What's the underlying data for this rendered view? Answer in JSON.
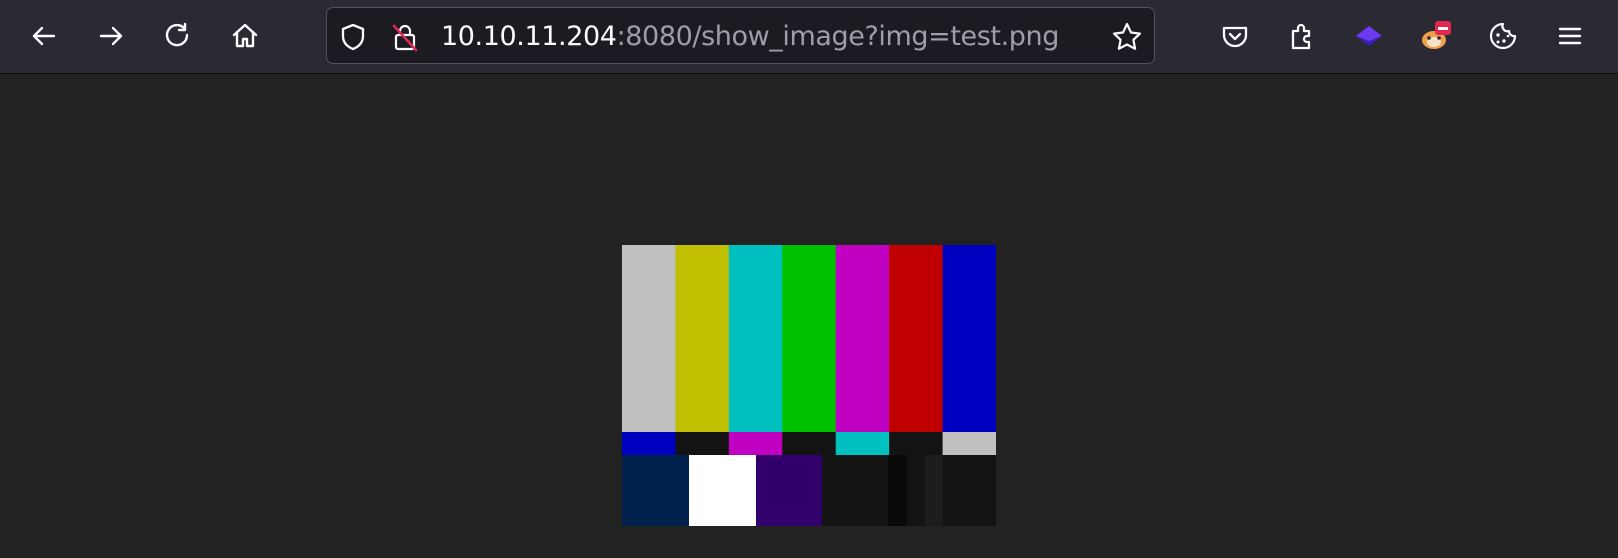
{
  "browser": {
    "toolbar": {
      "back_icon": "arrow-left-icon",
      "forward_icon": "arrow-right-icon",
      "reload_icon": "reload-icon",
      "home_icon": "home-icon"
    },
    "urlbar": {
      "url_host": "10.10.11.204",
      "url_rest": ":8080/show_image?img=test.png",
      "tracking_icon": "shield-icon",
      "insecure_icon": "insecure-lock-icon",
      "bookmark_icon": "star-icon"
    },
    "extensions": [
      "pocket-icon",
      "extensions-icon",
      "layers-extension-icon",
      "foxyproxy-icon",
      "cookie-icon",
      "hamburger-menu-icon"
    ]
  },
  "page": {
    "image_name": "test.png",
    "colors": {
      "top_bars": [
        "#c0c0c0",
        "#c0c000",
        "#00c0c0",
        "#00c000",
        "#c000c0",
        "#c00000",
        "#0000c0"
      ],
      "middle_bars": [
        "#0000c0",
        "#131313",
        "#c000c0",
        "#131313",
        "#00c0c0",
        "#131313",
        "#c0c0c0"
      ],
      "bottom_bars": [
        "#00214c",
        "#ffffff",
        "#32006a",
        "#131313",
        "#090909",
        "#131313",
        "#1d1d1d",
        "#131313"
      ]
    }
  }
}
